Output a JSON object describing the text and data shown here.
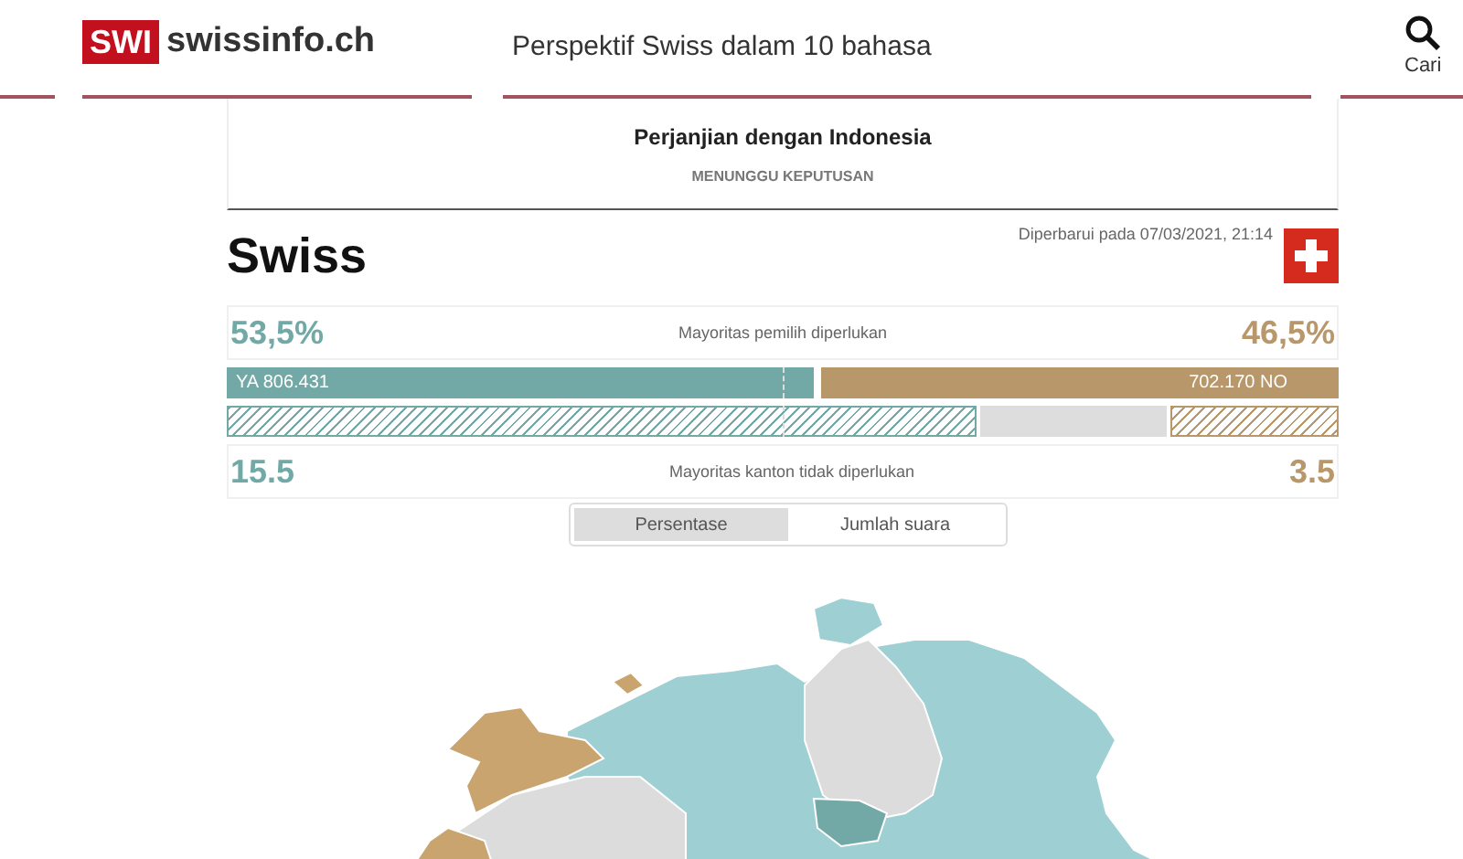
{
  "header": {
    "logo_badge": "SWI",
    "logo_text": "swissinfo.ch",
    "tagline": "Perspektif Swiss dalam 10 bahasa",
    "search_label": "Cari"
  },
  "vote": {
    "title": "Perjanjian dengan Indonesia",
    "status": "MENUNGGU KEPUTUSAN"
  },
  "region": {
    "name": "Swiss",
    "updated": "Diperbarui pada 07/03/2021, 21:14"
  },
  "popular": {
    "yes_percent": "53,5%",
    "label": "Mayoritas pemilih diperlukan",
    "no_percent": "46,5%",
    "yes_text": "YA 806.431",
    "no_text": "702.170 NO",
    "level": 0.535
  },
  "cantons": {
    "yes": "15.5",
    "label": "Mayoritas kanton tidak diperlukan",
    "no": "3.5",
    "yes_bar": {
      "level": 0.674
    },
    "no_bar": {
      "level": 0.152
    }
  },
  "toggle": [
    {
      "label": "Persentase",
      "selected": true
    },
    {
      "label": "Jumlah suara",
      "selected": false
    }
  ]
}
